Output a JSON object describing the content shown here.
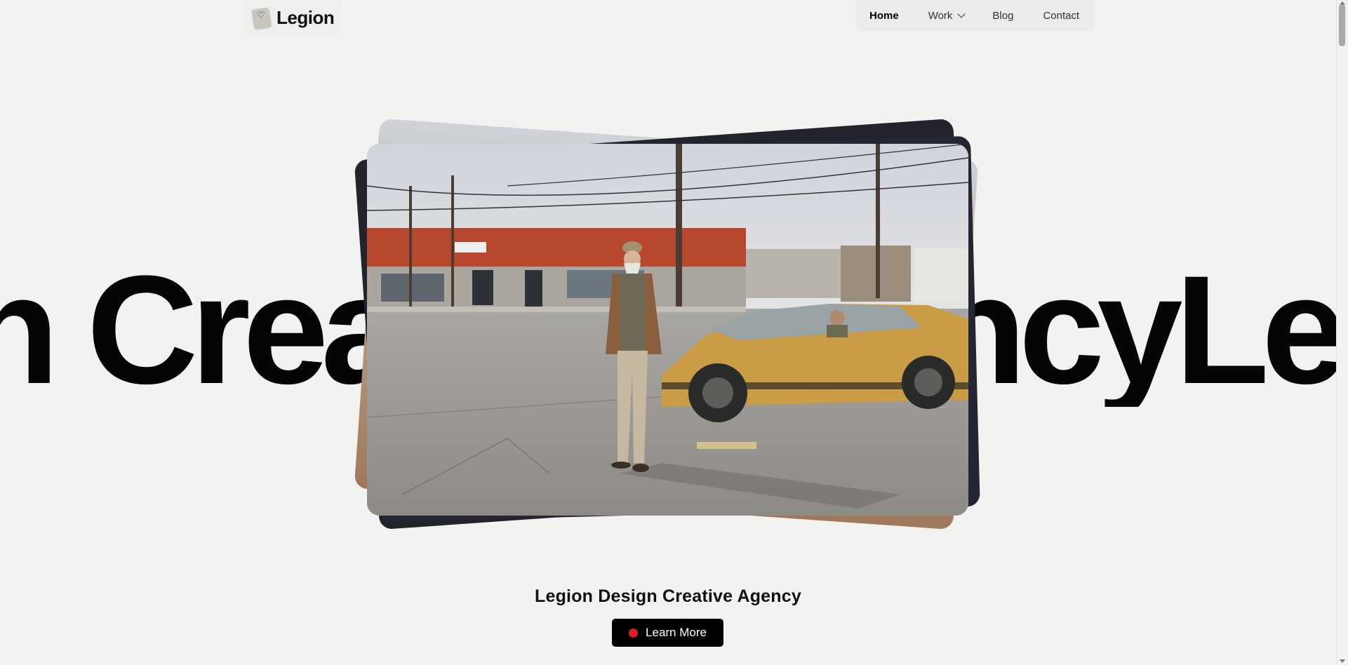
{
  "header": {
    "logo_icon": "heart-sticker-icon",
    "logo_text": "Legion"
  },
  "nav": {
    "items": [
      {
        "label": "Home",
        "active": true
      },
      {
        "label": "Work",
        "has_dropdown": true,
        "icon": "chevron-down-icon"
      },
      {
        "label": "Blog"
      },
      {
        "label": "Contact"
      }
    ]
  },
  "hero": {
    "marquee_text": "n Creative AgencyLegi",
    "image_alt_subject": "elderly bearded man standing on street beside yellow car"
  },
  "tagline": "Legion Design Creative Agency",
  "cta": {
    "label": "Learn More",
    "dot_color": "#e21b2c"
  },
  "colors": {
    "background": "#f2f2f1",
    "text": "#050505",
    "cta_bg": "#000000"
  }
}
